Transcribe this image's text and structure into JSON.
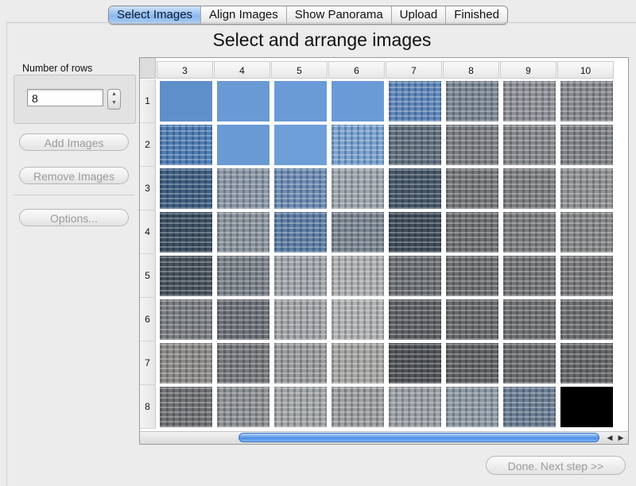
{
  "tabs": [
    {
      "label": "Select Images",
      "active": true
    },
    {
      "label": "Align Images",
      "active": false
    },
    {
      "label": "Show Panorama",
      "active": false
    },
    {
      "label": "Upload",
      "active": false
    },
    {
      "label": "Finished",
      "active": false
    }
  ],
  "page_title": "Select and arrange images",
  "rows_control": {
    "label": "Number of rows",
    "value": "8"
  },
  "side_buttons": {
    "add": "Add Images",
    "remove": "Remove Images",
    "options": "Options..."
  },
  "grid": {
    "columns": [
      "3",
      "4",
      "5",
      "6",
      "7",
      "8",
      "9",
      "10"
    ],
    "rows": [
      "1",
      "2",
      "3",
      "4",
      "5",
      "6",
      "7",
      "8"
    ],
    "cell_tones": [
      [
        "#5f8fc9",
        "#6a9ad4",
        "#6b9bd6",
        "#6b9bd6",
        "#5e87bd",
        "#7a8794",
        "#8d9096",
        "#878a8f"
      ],
      [
        "#4f7fb8",
        "#6a9ad4",
        "#6f9fd8",
        "#7aa4d4",
        "#606f7e",
        "#7b7e82",
        "#85888c",
        "#808387"
      ],
      [
        "#3f5f83",
        "#8b98a8",
        "#6d8db6",
        "#9ea6ae",
        "#46576a",
        "#757779",
        "#7e8083",
        "#909294"
      ],
      [
        "#3c4f63",
        "#8a949e",
        "#5d7ea6",
        "#7a8592",
        "#3f4c59",
        "#6e7073",
        "#7b7d80",
        "#848688"
      ],
      [
        "#46525d",
        "#7a8189",
        "#a0a6ac",
        "#aeb1b4",
        "#6b6f73",
        "#6c6e71",
        "#737578",
        "#78797b"
      ],
      [
        "#7a7e83",
        "#6b7178",
        "#a4a7aa",
        "#b1b3b5",
        "#5d6064",
        "#686a6d",
        "#6e7073",
        "#6d6f72"
      ],
      [
        "#8c8b88",
        "#75787c",
        "#9a9b9c",
        "#a6a6a5",
        "#4f5357",
        "#5f6164",
        "#6a6b6e",
        "#65676a"
      ],
      [
        "#6f7174",
        "#8d9194",
        "#a3a6a9",
        "#9d9fa2",
        "#9aa0a6",
        "#8e9aa5",
        "#6b7e95",
        "#000000"
      ]
    ],
    "sky_cells": [
      "1-1",
      "1-2",
      "1-3",
      "1-4",
      "2-2",
      "2-3"
    ],
    "black_cells": [
      "8-8"
    ]
  },
  "footer": {
    "next_label": "Done.  Next step >>"
  },
  "colors": {
    "tab_active": "#8bb8ee",
    "scroll_thumb": "#4d8fe6"
  },
  "icons": {
    "scroll_left": "◀",
    "scroll_right": "▶",
    "step_up": "▲",
    "step_down": "▼"
  }
}
